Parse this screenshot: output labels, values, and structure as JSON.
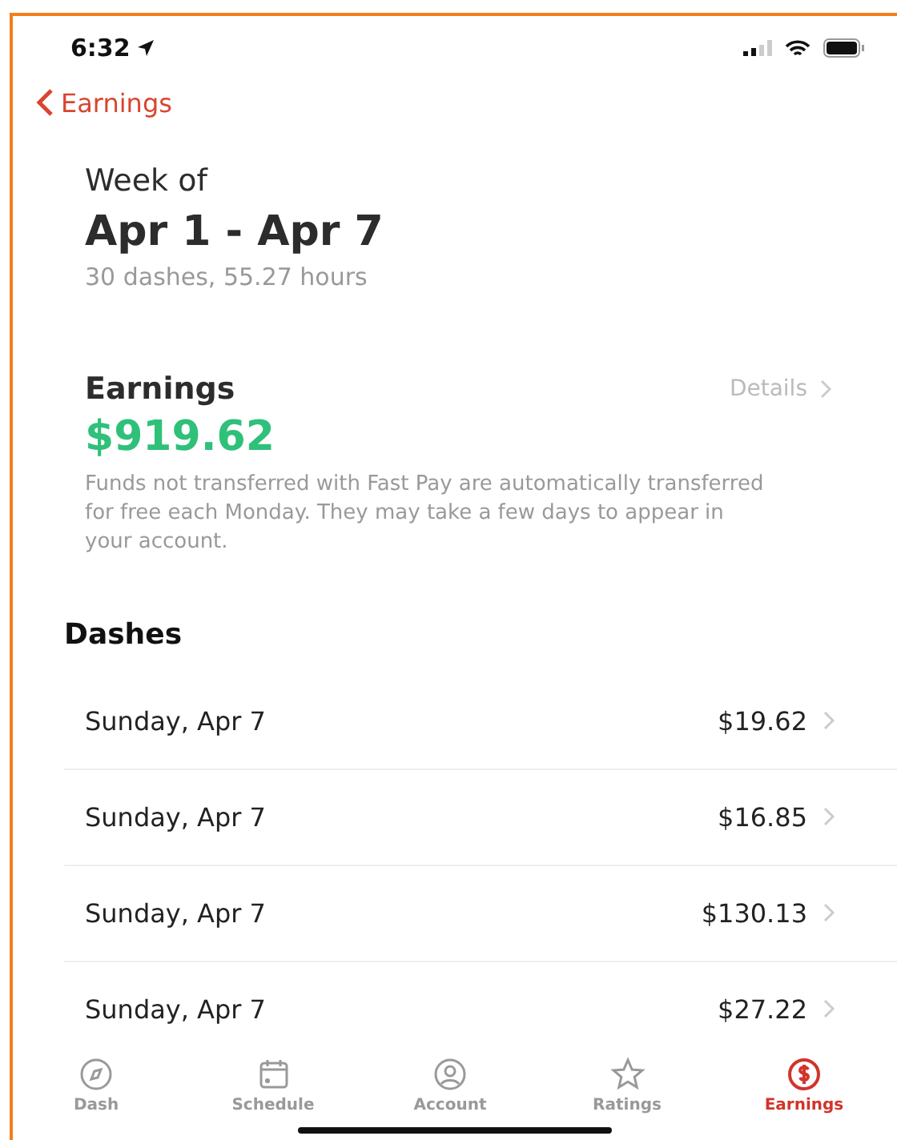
{
  "status_bar": {
    "time": "6:32"
  },
  "nav": {
    "back_label": "Earnings"
  },
  "week": {
    "label": "Week of",
    "range": "Apr 1 - Apr 7",
    "summary": "30 dashes, 55.27 hours"
  },
  "earnings": {
    "title": "Earnings",
    "details": "Details",
    "amount": "$919.62",
    "note": "Funds not transferred with Fast Pay are automatically transferred for free each Monday. They may take a few days to appear in your account."
  },
  "dashes": {
    "title": "Dashes",
    "rows": [
      {
        "date": "Sunday, Apr 7",
        "amount": "$19.62"
      },
      {
        "date": "Sunday, Apr 7",
        "amount": "$16.85"
      },
      {
        "date": "Sunday, Apr 7",
        "amount": "$130.13"
      },
      {
        "date": "Sunday, Apr 7",
        "amount": "$27.22"
      }
    ]
  },
  "tab_bar": [
    {
      "kind": "dash",
      "label": "Dash",
      "selected": false
    },
    {
      "kind": "schedule",
      "label": "Schedule",
      "selected": false
    },
    {
      "kind": "account",
      "label": "Account",
      "selected": false
    },
    {
      "kind": "ratings",
      "label": "Ratings",
      "selected": false
    },
    {
      "kind": "earnings",
      "label": "Earnings",
      "selected": true
    }
  ]
}
